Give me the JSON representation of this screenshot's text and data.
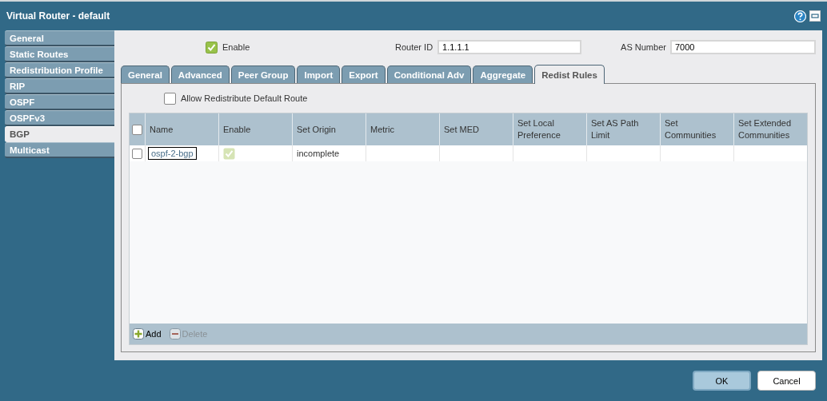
{
  "window": {
    "title": "Virtual Router - default"
  },
  "sidebar": {
    "items": [
      {
        "label": "General",
        "selected": false
      },
      {
        "label": "Static Routes",
        "selected": false
      },
      {
        "label": "Redistribution Profile",
        "selected": false
      },
      {
        "label": "RIP",
        "selected": false
      },
      {
        "label": "OSPF",
        "selected": false
      },
      {
        "label": "OSPFv3",
        "selected": false
      },
      {
        "label": "BGP",
        "selected": true
      },
      {
        "label": "Multicast",
        "selected": false
      }
    ]
  },
  "header": {
    "enable": {
      "label": "Enable",
      "checked": true
    },
    "router_id": {
      "label": "Router ID",
      "value": "1.1.1.1"
    },
    "as_number": {
      "label": "AS Number",
      "value": "7000"
    }
  },
  "tabs": [
    {
      "label": "General",
      "selected": false
    },
    {
      "label": "Advanced",
      "selected": false
    },
    {
      "label": "Peer Group",
      "selected": false
    },
    {
      "label": "Import",
      "selected": false
    },
    {
      "label": "Export",
      "selected": false
    },
    {
      "label": "Conditional Adv",
      "selected": false
    },
    {
      "label": "Aggregate",
      "selected": false
    },
    {
      "label": "Redist Rules",
      "selected": true
    }
  ],
  "allow_default_route": {
    "label": "Allow Redistribute Default Route",
    "checked": false
  },
  "table": {
    "select_all_checked": false,
    "columns": [
      "Name",
      "Enable",
      "Set Origin",
      "Metric",
      "Set MED",
      "Set Local Preference",
      "Set AS Path Limit",
      "Set Communities",
      "Set Extended Communities"
    ],
    "rows": [
      {
        "selected": false,
        "name": "ospf-2-bgp",
        "enable": true,
        "set_origin": "incomplete"
      }
    ]
  },
  "toolbar": [
    {
      "label": "Add",
      "kind": "add",
      "disabled": false
    },
    {
      "label": "Delete",
      "kind": "delete",
      "disabled": true
    }
  ],
  "buttons": [
    {
      "label": "OK",
      "kind": "primary"
    },
    {
      "label": "Cancel",
      "kind": "secondary"
    }
  ]
}
